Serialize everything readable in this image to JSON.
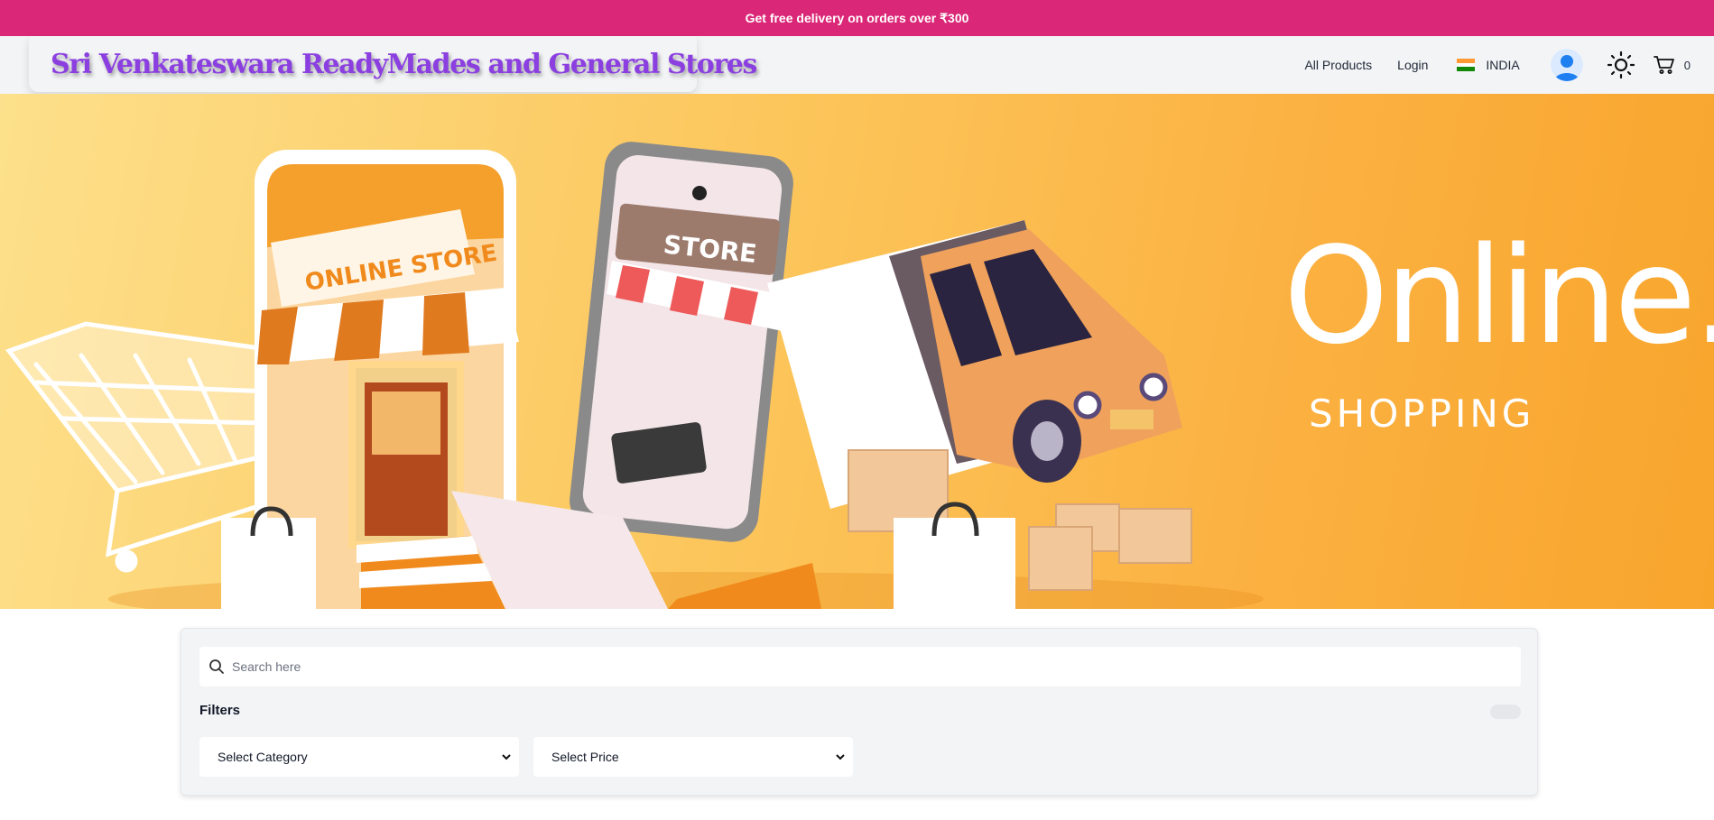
{
  "promo": {
    "text": "Get free delivery on orders over ₹300"
  },
  "header": {
    "brand": "Sri Venkateswara ReadyMades and General Stores",
    "nav": {
      "all_products": "All Products",
      "login": "Login"
    },
    "country": {
      "name": "INDIA",
      "flag_icon": "india-flag-icon"
    },
    "icons": {
      "avatar": "user-avatar-icon",
      "theme": "sun-icon",
      "cart": "cart-icon"
    },
    "cart_count": "0"
  },
  "hero": {
    "title": "Online.",
    "subtitle": "SHOPPING",
    "store_sign": "ONLINE STORE",
    "phone_sign": "STORE"
  },
  "search": {
    "placeholder": "Search here"
  },
  "filters": {
    "label": "Filters",
    "category": {
      "selected": "Select Category",
      "options": [
        "Select Category"
      ]
    },
    "price": {
      "selected": "Select Price",
      "options": [
        "Select Price"
      ]
    }
  },
  "colors": {
    "promo_bg": "#db2777",
    "brand_text": "#8b3fe0",
    "hero_bg": "#fbb040"
  }
}
